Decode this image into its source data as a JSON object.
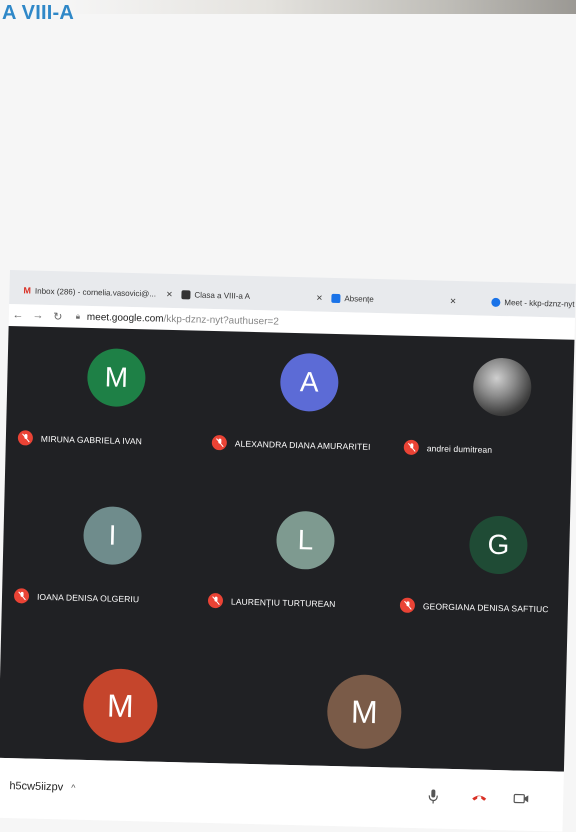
{
  "page_title": "A VIII-A",
  "tabs": [
    {
      "label": "Inbox (286) - cornelia.vasovici@...",
      "icon": "gmail-icon",
      "color": "#d93025"
    },
    {
      "label": "Clasa a VIII-a A",
      "icon": "classroom-icon",
      "color": "#222222"
    },
    {
      "label": "Absențe",
      "icon": "docs-icon",
      "color": "#1a73e8"
    },
    {
      "label": "Meet - kkp-dznz-nyt",
      "icon": "meet-icon",
      "color": "#1a73e8"
    }
  ],
  "address": {
    "host": "meet.google.com",
    "path": "/kkp-dznz-nyt?authuser=2"
  },
  "participants": [
    {
      "name": "MIRUNA GABRIELA IVAN",
      "initial": "M",
      "avatar_color": "#1e8046"
    },
    {
      "name": "ALEXANDRA DIANA AMURARITEI",
      "initial": "A",
      "avatar_color": "#5c6bd6"
    },
    {
      "name": "andrei dumitrean",
      "initial": "",
      "avatar_color": "#6b6b6b",
      "photo": true
    },
    {
      "name": "IOANA DENISA OLGERIU",
      "initial": "I",
      "avatar_color": "#6f8c8c"
    },
    {
      "name": "LAURENȚIU TURTUREAN",
      "initial": "L",
      "avatar_color": "#7e9a90"
    },
    {
      "name": "GEORGIANA DENISA SAFTIUC",
      "initial": "G",
      "avatar_color": "#1f4b35"
    },
    {
      "name": "",
      "initial": "M",
      "avatar_color": "#c5452c"
    },
    {
      "name": "",
      "initial": "M",
      "avatar_color": "#7a5b48"
    }
  ],
  "meeting_code": "h5cw5iizpv",
  "controls": {
    "mic": "microphone-icon",
    "leave": "hang-up-icon",
    "camera": "camera-icon"
  }
}
